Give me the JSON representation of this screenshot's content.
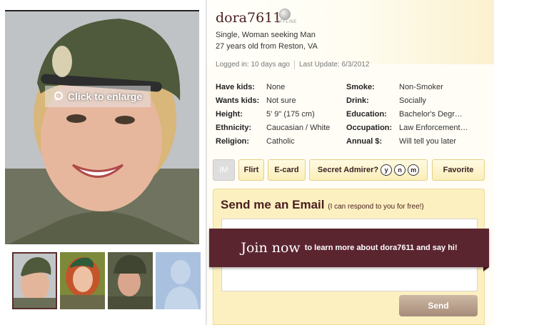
{
  "profile": {
    "username": "dora7611",
    "status": "OFFLINE",
    "summary_line1": "Single, Woman seeking Man",
    "summary_line2": "27 years old from Reston, VA",
    "logged_in": "Logged in: 10 days ago",
    "last_update": "Last Update: 6/3/2012"
  },
  "photo": {
    "enlarge_label": "Click to enlarge",
    "thumbnails": [
      "soldier-beret",
      "red-hair-beret",
      "helmet-soldier",
      "silhouette-placeholder"
    ],
    "selected_index": 0
  },
  "details_left": [
    {
      "label": "Have kids:",
      "value": "None"
    },
    {
      "label": "Wants kids:",
      "value": "Not sure"
    },
    {
      "label": "Height:",
      "value": "5' 9\" (175 cm)"
    },
    {
      "label": "Ethnicity:",
      "value": "Caucasian / White"
    },
    {
      "label": "Religion:",
      "value": "Catholic"
    }
  ],
  "details_right": [
    {
      "label": "Smoke:",
      "value": "Non-Smoker"
    },
    {
      "label": "Drink:",
      "value": "Socially"
    },
    {
      "label": "Education:",
      "value": "Bachelor's Degr…"
    },
    {
      "label": "Occupation:",
      "value": "Law Enforcement…"
    },
    {
      "label": "Annual $:",
      "value": "Will tell you later"
    }
  ],
  "actions": {
    "im": "IM",
    "flirt": "Flirt",
    "ecard": "E-card",
    "admirer": "Secret Admirer?",
    "admirer_y": "y",
    "admirer_n": "n",
    "admirer_m": "m",
    "favorite": "Favorite"
  },
  "email": {
    "title": "Send me an Email",
    "subtitle": "(I can respond to you for free!)",
    "send": "Send"
  },
  "banner": {
    "join": "Join now",
    "text": "to learn more about dora7611 and say hi!"
  },
  "colors": {
    "brand_maroon": "#5b2530",
    "button_cream": "#fbeeb9",
    "email_bg": "#fcf0c0"
  }
}
